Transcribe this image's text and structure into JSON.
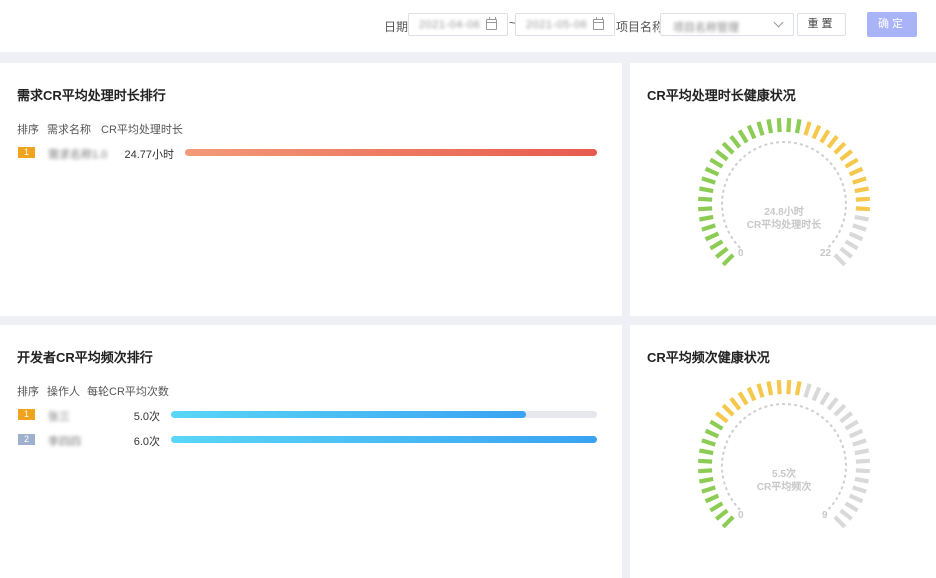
{
  "filters": {
    "date_label": "日期",
    "date_start": "2021-04-06",
    "date_end": "2021-05-06",
    "date_sep": "~",
    "project_label": "项目名称",
    "project_value": "项目名称管理",
    "reset_label": "重置",
    "confirm_label": "确定"
  },
  "cr_rank": {
    "title": "需求CR平均处理时长排行",
    "headers": [
      "排序",
      "需求名称",
      "CR平均处理时长"
    ],
    "rows": [
      {
        "rank": "1",
        "name": "需求名称1.0",
        "value": "24.77小时",
        "ratio": 1.0
      }
    ]
  },
  "cr_health": {
    "title": "CR平均处理时长健康状况",
    "center_value": "24.8小时",
    "center_label": "CR平均处理时长",
    "min": "0",
    "max": "22",
    "value": 24.8,
    "range": [
      0,
      22
    ]
  },
  "dev_rank": {
    "title": "开发者CR平均频次排行",
    "headers": [
      "排序",
      "操作人",
      "每轮CR平均次数"
    ],
    "rows": [
      {
        "rank": "1",
        "name": "张三",
        "value": "5.0次",
        "ratio": 0.833
      },
      {
        "rank": "2",
        "name": "李四四",
        "value": "6.0次",
        "ratio": 1.0
      }
    ]
  },
  "freq_health": {
    "title": "CR平均频次健康状况",
    "center_value": "5.5次",
    "center_label": "CR平均频次",
    "min": "0",
    "max": "9",
    "value": 5.5,
    "range": [
      0,
      9
    ]
  },
  "colors": {
    "accent": "#a9b3f8",
    "green": "#8ccc55",
    "yellow": "#f5c84d",
    "gray": "#d9d9d9",
    "bar_red_start": "#f39a78",
    "bar_red_end": "#e85a4f",
    "bar_blue_start": "#5ad6f6",
    "bar_blue_end": "#3aa3f2",
    "rank1": "#f0a31d",
    "rank2": "#9fb0cd"
  }
}
